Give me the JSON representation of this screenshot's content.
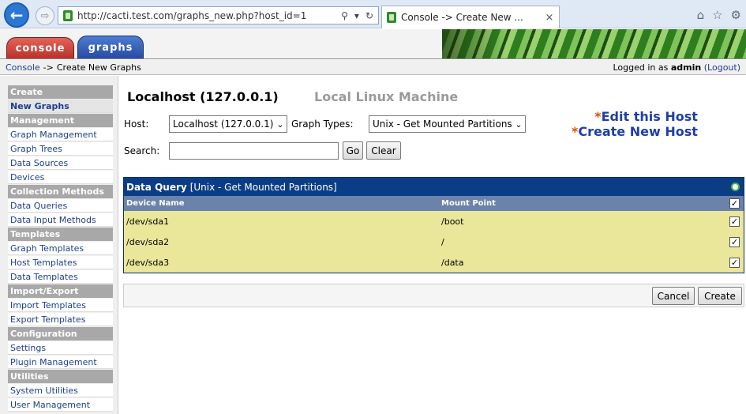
{
  "browser": {
    "url": "http://cacti.test.com/graphs_new.php?host_id=1",
    "tab_title": "Console -> Create New ...",
    "back": "←",
    "forward": "⇨",
    "tab_close": "×"
  },
  "header": {
    "tabs": [
      {
        "label": "console"
      },
      {
        "label": "graphs"
      }
    ]
  },
  "breadcrumb": {
    "console": "Console",
    "sep": "->",
    "current": "Create New Graphs",
    "logged_in_prefix": "Logged in as",
    "user": "admin",
    "logout": "(Logout)"
  },
  "sidebar": {
    "items": [
      {
        "label": "Create",
        "type": "header"
      },
      {
        "label": "New Graphs",
        "type": "item",
        "active": true
      },
      {
        "label": "Management",
        "type": "header"
      },
      {
        "label": "Graph Management",
        "type": "item"
      },
      {
        "label": "Graph Trees",
        "type": "item"
      },
      {
        "label": "Data Sources",
        "type": "item"
      },
      {
        "label": "Devices",
        "type": "item"
      },
      {
        "label": "Collection Methods",
        "type": "header"
      },
      {
        "label": "Data Queries",
        "type": "item"
      },
      {
        "label": "Data Input Methods",
        "type": "item"
      },
      {
        "label": "Templates",
        "type": "header"
      },
      {
        "label": "Graph Templates",
        "type": "item"
      },
      {
        "label": "Host Templates",
        "type": "item"
      },
      {
        "label": "Data Templates",
        "type": "item"
      },
      {
        "label": "Import/Export",
        "type": "header"
      },
      {
        "label": "Import Templates",
        "type": "item"
      },
      {
        "label": "Export Templates",
        "type": "item"
      },
      {
        "label": "Configuration",
        "type": "header"
      },
      {
        "label": "Settings",
        "type": "item"
      },
      {
        "label": "Plugin Management",
        "type": "item"
      },
      {
        "label": "Utilities",
        "type": "header"
      },
      {
        "label": "System Utilities",
        "type": "item"
      },
      {
        "label": "User Management",
        "type": "item"
      }
    ]
  },
  "main": {
    "host_title": "Localhost (127.0.0.1)",
    "host_desc": "Local Linux Machine",
    "host_label": "Host:",
    "host_value": "Localhost (127.0.0.1)",
    "graph_types_label": "Graph Types:",
    "graph_types_value": "Unix - Get Mounted Partitions",
    "search_label": "Search:",
    "search_value": "",
    "go": "Go",
    "clear": "Clear",
    "edit_host": "Edit this Host",
    "create_host": "Create New Host",
    "star": "*"
  },
  "data_query": {
    "title": "Data Query",
    "subtitle": "[Unix - Get Mounted Partitions]",
    "col_device": "Device Name",
    "col_mount": "Mount Point",
    "header_checked": true,
    "rows": [
      {
        "device": "/dev/sda1",
        "mount": "/boot",
        "checked": true
      },
      {
        "device": "/dev/sda2",
        "mount": "/",
        "checked": true
      },
      {
        "device": "/dev/sda3",
        "mount": "/data",
        "checked": true
      }
    ]
  },
  "actions": {
    "cancel": "Cancel",
    "create": "Create"
  },
  "checkmark": "✓"
}
